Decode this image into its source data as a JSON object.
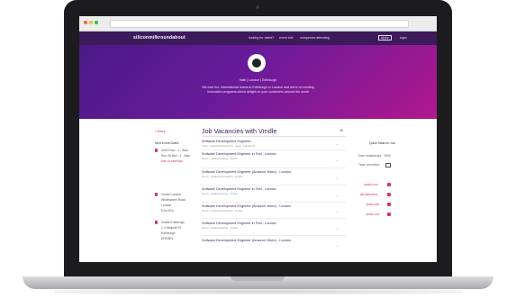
{
  "site": {
    "logo": "siliconmilkroundabout",
    "nav": [
      "looking for talent?",
      "event info",
      "companies attending",
      "apply",
      "login"
    ]
  },
  "hero": {
    "locations": "Hate  |  London  |  Edinburgh",
    "text_1": "We love fun, international teams in Edinburgh or London and we're on exciting",
    "text_2": "innovative programs which delight on your customers around the world"
  },
  "content": {
    "back_label": "« Back",
    "title": "Job Vacancies with Vmdle",
    "count": "35"
  },
  "sidebar": {
    "heading": "Next Event Dates",
    "event_lines": [
      "04/10 Nov - 1 - 5am",
      "Sun 30 Nov - 1 - 5am",
      "Add to calendar"
    ],
    "office_1": [
      "Vmdle London",
      "Whitehaven Road",
      "London",
      "E1w 2Ed"
    ],
    "office_2": [
      "Vmdle Edinburgh",
      "1-4 Walpole Pl",
      "Edinburgh",
      "EH9 8Ex"
    ]
  },
  "jobs": [
    {
      "title": "Software Development Engineer",
      "sub": "Team: Android/Mobile/iOS - gogo, Edinburgh"
    },
    {
      "title": "Software Development Engineer in Test - London",
      "sub": "Team: mobile/desktop - Dublin"
    },
    {
      "title": "Software Development Engineer (Amazon Video) - London",
      "sub": "Team: mobile/android/iOS - Dublin"
    },
    {
      "title": "Software Development Engineer in Test - London",
      "sub": "Team: mobile/desktop - Dublin"
    },
    {
      "title": "Software Development Engineer (Amazon Video) - London",
      "sub": "Team: mobile/android/iOS - Dublin"
    },
    {
      "title": "Software Development Engineer in Test - London",
      "sub": "Team: mobile/desktop - Dublin"
    },
    {
      "title": "Software Development Engineer (Amazon Video) - London",
      "sub": ""
    }
  ],
  "right": {
    "heading": "Quick Stats for Job",
    "stat_1": "Date established · 1995",
    "stat_2": "Team members",
    "socials": [
      "vmdle.com",
      "@vmdlenews",
      "vmdle.jobs",
      "vmdle.com"
    ]
  },
  "colors": {
    "nav_bg": "#3d1a5b",
    "hero_start": "#4a1a86",
    "hero_end": "#b0188e",
    "accent": "#d8325b",
    "title": "#3d1a5b",
    "traffic_red": "#ff5f57",
    "traffic_yellow": "#febc2e",
    "traffic_green": "#28c840"
  },
  "icons": {
    "badge": "company-logo-icon",
    "arrow": "arrow-right-icon",
    "pin": "map-pin-icon",
    "calendar": "calendar-icon"
  }
}
